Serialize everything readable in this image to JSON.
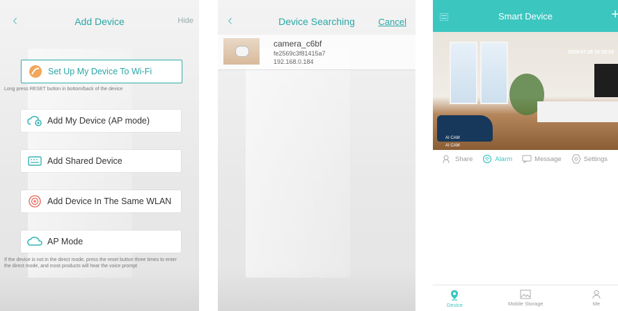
{
  "screen1": {
    "back_icon": "chevron-left-icon",
    "title": "Add Device",
    "hide": "Hide",
    "wifi_label": "Set Up My Device To Wi-Fi",
    "wifi_hint": "Long press RESET button in bottom/back of the device",
    "ap_label": "Add My Device (AP mode)",
    "shared_label": "Add Shared Device",
    "wlan_label": "Add Device In The Same WLAN",
    "apmode_label": "AP Mode",
    "apmode_hint": "If the device is not in the direct mode, press the reset button three times to enter the direct mode, and most products will hear the voice prompt"
  },
  "screen2": {
    "back_icon": "chevron-left-icon",
    "title": "Device Searching",
    "cancel": "Cancel",
    "device": {
      "name": "camera_c6bf",
      "id": "fe2569c3f81415a7",
      "ip": "192.168.0.184"
    }
  },
  "screen3": {
    "title": "Smart Device",
    "plus": "+",
    "timestamp": "2019-07-26 10:28:03",
    "watermark1": "AI CAM",
    "watermark2": "AI CAM",
    "actions": [
      "Share",
      "Alarm",
      "Message",
      "Settings"
    ],
    "tabs": [
      "Device",
      "Mobile Storage",
      "Me"
    ],
    "accent_color": "#3cc6c0"
  }
}
